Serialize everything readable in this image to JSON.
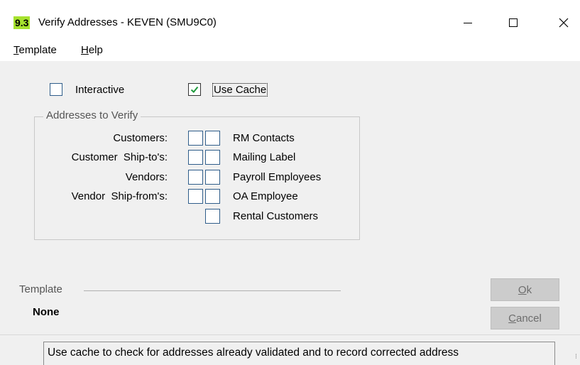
{
  "window": {
    "badge": "9.3",
    "title": "Verify Addresses - KEVEN (SMU9C0)",
    "colors": {
      "badge_bg": "#a6e22e"
    }
  },
  "menu": {
    "template": {
      "mnemonic": "T",
      "rest": "emplate"
    },
    "help": {
      "mnemonic": "H",
      "rest": "elp"
    }
  },
  "options": {
    "interactive": {
      "label": "Interactive",
      "checked": false
    },
    "use_cache": {
      "label": "Use Cache",
      "checked": true
    }
  },
  "addresses": {
    "legend": "Addresses to Verify",
    "left_labels": [
      "Customers:",
      "Customer  Ship-to's:",
      "Vendors:",
      "Vendor  Ship-from's:"
    ],
    "right_labels": [
      "RM Contacts",
      "Mailing Label",
      "Payroll Employees",
      "OA Employee",
      "Rental Customers"
    ]
  },
  "template": {
    "legend": "Template",
    "value": "None"
  },
  "buttons": {
    "ok": {
      "mnemonic": "O",
      "rest": "k"
    },
    "cancel": {
      "mnemonic": "C",
      "rest": "ancel"
    }
  },
  "status": {
    "text": "Use cache to check for addresses already validated and to record corrected address"
  },
  "icons": {
    "minimize": "minimize-icon",
    "maximize": "maximize-icon",
    "close": "close-icon",
    "check": "checkmark-icon",
    "grip": "resize-grip-icon"
  }
}
